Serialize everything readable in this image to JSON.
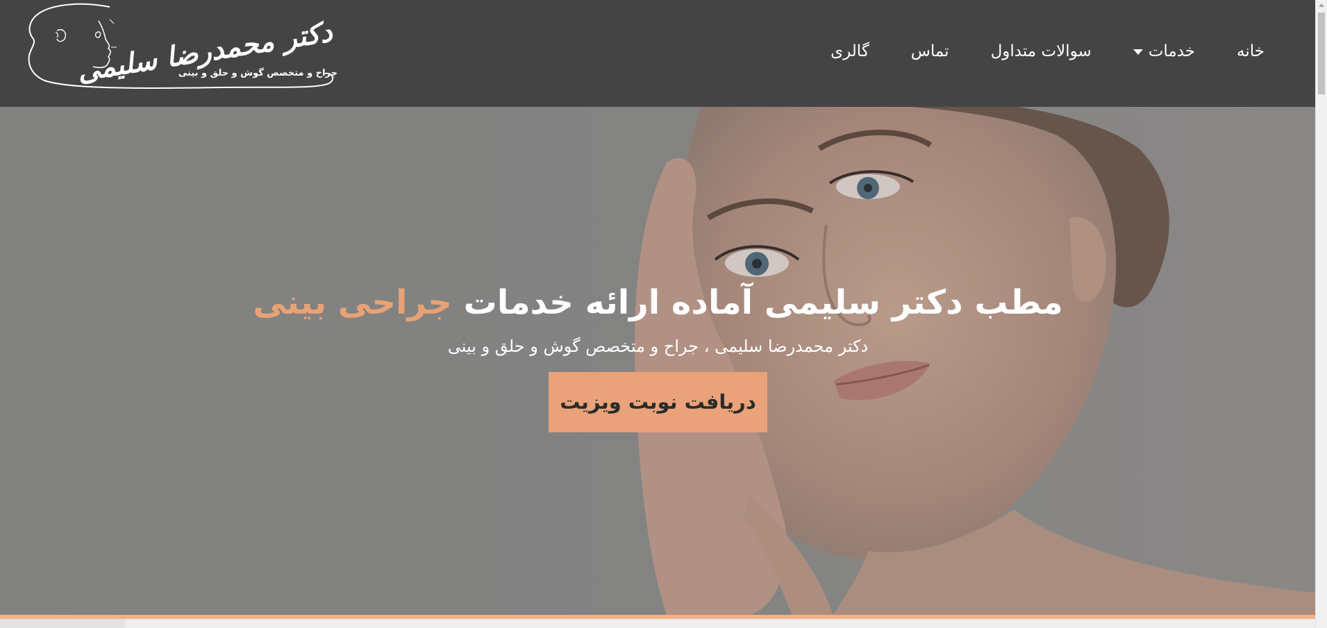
{
  "header": {
    "logo": {
      "name": "دکتر محمدرضا سلیمی",
      "tagline": "جراح و متخصص گوش و حلق و بینی"
    },
    "nav": {
      "home": "خانه",
      "services": "خدمات",
      "faq": "سوالات متداول",
      "contact": "تماس",
      "gallery": "گالری"
    }
  },
  "hero": {
    "title_main": "مطب دکتر سلیمی آماده ارائه خدمات",
    "title_accent": "جراحی بینی",
    "subtitle": "دکتر محمدرضا سلیمی ، جراح و متخصص گوش و حلق و بینی",
    "cta_label": "دریافت نوبت ویزیت"
  },
  "colors": {
    "header_bg": "#444444",
    "accent": "#e9a27a",
    "hero_overlay": "#8a8a88"
  },
  "icons": {
    "nav_services_dropdown": "caret-down-icon",
    "logo_profile": "face-profile-icon"
  }
}
